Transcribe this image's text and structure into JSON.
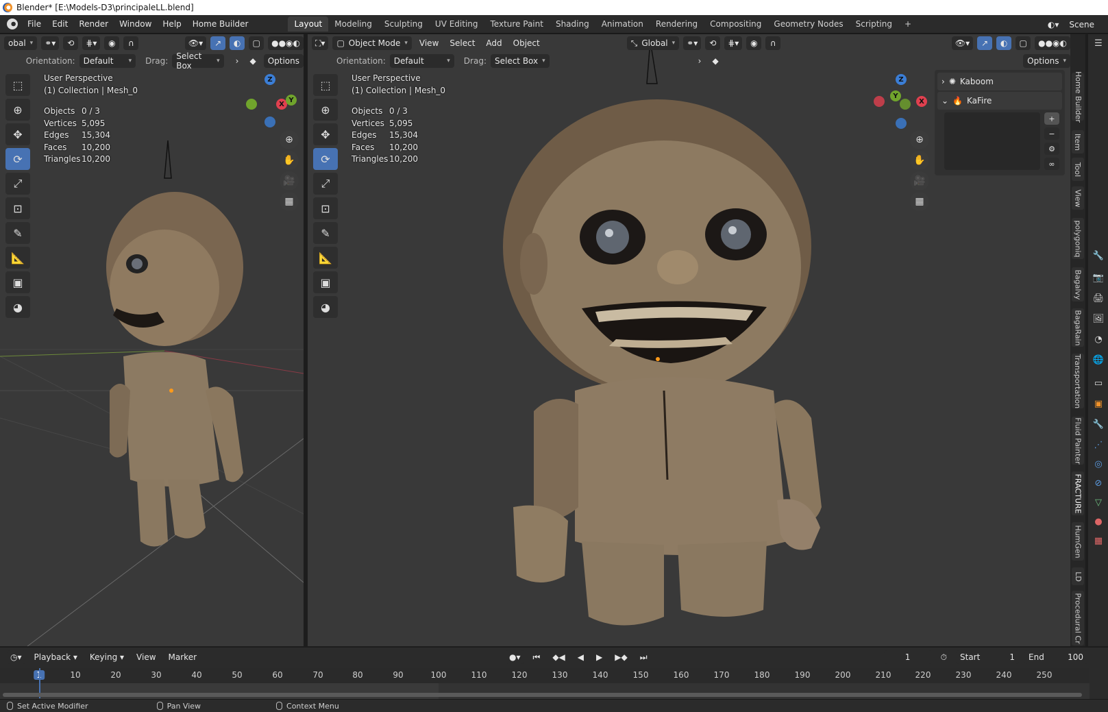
{
  "window": {
    "title": "Blender* [E:\\Models-D3\\principaleLL.blend]"
  },
  "menu": [
    "File",
    "Edit",
    "Render",
    "Window",
    "Help",
    "Home Builder"
  ],
  "workspace_tabs": [
    "Layout",
    "Modeling",
    "Sculpting",
    "UV Editing",
    "Texture Paint",
    "Shading",
    "Animation",
    "Rendering",
    "Compositing",
    "Geometry Nodes",
    "Scripting"
  ],
  "active_tab": "Layout",
  "scene": {
    "label": "Scene"
  },
  "left_viewport": {
    "transform_orientation": "obal",
    "orientation_label": "Orientation:",
    "orientation_value": "Default",
    "drag_label": "Drag:",
    "drag_value": "Select Box",
    "options_label": "Options",
    "perspective": "User Perspective",
    "collection": "(1) Collection | Mesh_0",
    "stats": [
      {
        "k": "Objects",
        "v": "0 / 3"
      },
      {
        "k": "Vertices",
        "v": "5,095"
      },
      {
        "k": "Edges",
        "v": "15,304"
      },
      {
        "k": "Faces",
        "v": "10,200"
      },
      {
        "k": "Triangles",
        "v": "10,200"
      }
    ]
  },
  "right_viewport": {
    "mode": "Object Mode",
    "menus": [
      "View",
      "Select",
      "Add",
      "Object"
    ],
    "transform_orientation": "Global",
    "orientation_label": "Orientation:",
    "orientation_value": "Default",
    "drag_label": "Drag:",
    "drag_value": "Select Box",
    "options_label": "Options",
    "perspective": "User Perspective",
    "collection": "(1) Collection | Mesh_0",
    "stats": [
      {
        "k": "Objects",
        "v": "0 / 3"
      },
      {
        "k": "Vertices",
        "v": "5,095"
      },
      {
        "k": "Edges",
        "v": "15,304"
      },
      {
        "k": "Faces",
        "v": "10,200"
      },
      {
        "k": "Triangles",
        "v": "10,200"
      }
    ]
  },
  "gizmo_axes": {
    "x": "X",
    "y": "Y",
    "z": "Z"
  },
  "npanel": {
    "items": [
      {
        "label": "Kaboom",
        "expanded": false
      },
      {
        "label": "KaFire",
        "expanded": true
      }
    ]
  },
  "side_tabs": [
    "Home Builder",
    "Item",
    "Tool",
    "View",
    "polygoniq",
    "Bagalvy",
    "BagaRain",
    "Transportation",
    "Fluid Painter",
    "FRACTURE",
    "HumGen",
    "LD",
    "Procedural Cr"
  ],
  "timeline": {
    "menus": [
      "Playback",
      "Keying",
      "View",
      "Marker"
    ],
    "current_frame": "1",
    "start_label": "Start",
    "start": "1",
    "end_label": "End",
    "end": "100",
    "ticks": [
      "1",
      "10",
      "20",
      "30",
      "40",
      "50",
      "60",
      "70",
      "80",
      "90",
      "100",
      "110",
      "120",
      "130",
      "140",
      "150",
      "160",
      "170",
      "180",
      "190",
      "200",
      "210",
      "220",
      "230",
      "240",
      "250"
    ]
  },
  "status": [
    "Set Active Modifier",
    "Pan View",
    "Context Menu"
  ],
  "colors": {
    "accent": "#4772b3",
    "axis_x": "#e0404f",
    "axis_y": "#70a42c",
    "axis_z": "#3b7ed6"
  }
}
